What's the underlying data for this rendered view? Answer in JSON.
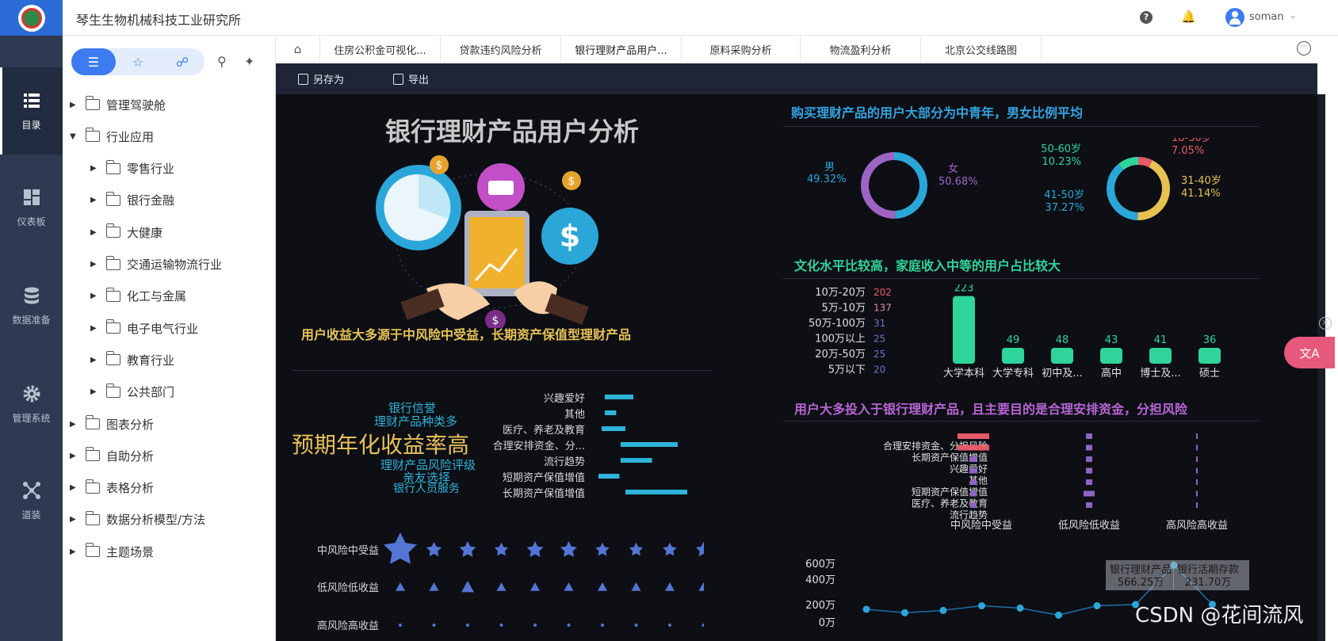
{
  "header": {
    "org": "琴生生物机械科技工业研究所",
    "help_glyph": "?",
    "user": "soman"
  },
  "nav": [
    {
      "label": "目录"
    },
    {
      "label": "仪表板"
    },
    {
      "label": "数据准备"
    },
    {
      "label": "管理系统"
    },
    {
      "label": "道装"
    }
  ],
  "tree": [
    {
      "label": "管理驾驶舱",
      "expanded": false
    },
    {
      "label": "行业应用",
      "expanded": true
    },
    {
      "label": "零售行业"
    },
    {
      "label": "银行金融"
    },
    {
      "label": "大健康"
    },
    {
      "label": "交通运输物流行业"
    },
    {
      "label": "化工与金属"
    },
    {
      "label": "电子电气行业"
    },
    {
      "label": "教育行业"
    },
    {
      "label": "公共部门"
    },
    {
      "label": "图表分析"
    },
    {
      "label": "自助分析"
    },
    {
      "label": "表格分析"
    },
    {
      "label": "数据分析模型/方法"
    },
    {
      "label": "主题场景"
    }
  ],
  "tabs": [
    {
      "label": "住房公积金可视化..."
    },
    {
      "label": "贷款违约风险分析"
    },
    {
      "label": "银行理财产品用户...",
      "active": true
    },
    {
      "label": "原料采购分析"
    },
    {
      "label": "物流盈利分析"
    },
    {
      "label": "北京公交线路图"
    }
  ],
  "toolbar": {
    "save_as": "另存为",
    "export": "导出"
  },
  "dashboard": {
    "title": "银行理财产品用户分析",
    "section_income": "用户收益大多源于中风险中受益，长期资产保值型理财产品",
    "section_age": "购买理财产品的用户大部分为中青年，男女比例平均",
    "section_edu": "文化水平比较高，家庭收入中等的用户占比较大",
    "section_purpose": "用户大多投入于银行理财产品，且主要目的是合理安排资金，分担风险"
  },
  "chart_data": [
    {
      "type": "pie",
      "title": "",
      "categories": [
        "男",
        "女"
      ],
      "values": [
        49.32,
        50.68
      ],
      "labels": [
        "49.32%",
        "50.68%"
      ]
    },
    {
      "type": "pie",
      "title": "",
      "categories": [
        "31-40岁",
        "41-50岁",
        "50-60岁",
        "18-30岁"
      ],
      "values": [
        41.14,
        37.27,
        10.23,
        7.05
      ],
      "labels": [
        "41.14%",
        "37.27%",
        "10.23%",
        "7.05%"
      ]
    },
    {
      "type": "table",
      "title": "",
      "rows": [
        [
          "10万-20万",
          "202"
        ],
        [
          "5万-10万",
          "137"
        ],
        [
          "50万-100万",
          "31"
        ],
        [
          "100万以上",
          "25"
        ],
        [
          "20万-50万",
          "25"
        ],
        [
          "5万以下",
          "20"
        ]
      ]
    },
    {
      "type": "bar",
      "title": "",
      "categories": [
        "大学本科",
        "大学专科",
        "初中及...",
        "高中",
        "博士及...",
        "硕士"
      ],
      "values": [
        223,
        49,
        48,
        43,
        41,
        36
      ],
      "ylim": [
        0,
        230
      ]
    },
    {
      "type": "bar",
      "title": "",
      "categories": [
        "兴趣爱好",
        "其他",
        "医疗、养老及教育",
        "合理安排资金、分...",
        "流行趋势",
        "短期资产保值增值",
        "长期资产保值增值"
      ],
      "values": [
        3,
        1.2,
        2.5,
        6,
        3.3,
        2.2,
        6.5
      ]
    },
    {
      "type": "scatter",
      "title": "",
      "categories": [
        "中风险中受益",
        "低风险低收益",
        "高风险高收益"
      ],
      "marks": [
        1,
        0.9,
        1,
        0.8,
        1,
        1,
        0.8,
        0.8,
        0.8,
        0.9
      ]
    },
    {
      "type": "line",
      "title": "",
      "ytick_labels": [
        "600万",
        "400万",
        "200万",
        "0万"
      ],
      "values": [
        190,
        160,
        180,
        220,
        200,
        140,
        220,
        230,
        566.25,
        231.7
      ],
      "annotations": [
        {
          "label": "银行理财产品",
          "value": "566.25万"
        },
        {
          "label": "银行活期存款",
          "value": "231.70万"
        }
      ],
      "ylim": [
        0,
        650
      ]
    }
  ],
  "wordcloud": [
    "银行信誉",
    "理财产品种类多",
    "预期年化收益率高",
    "理财产品风险评级",
    "亲友选择",
    "银行人员服务"
  ],
  "purpose_matrix": {
    "rows": [
      "合理安排资金、分担风险",
      "长期资产保值增值",
      "兴趣爱好",
      "其他",
      "短期资产保值增值",
      "医疗、养老及教育",
      "流行趋势"
    ],
    "cols": [
      "中风险中受益",
      "低风险低收益",
      "高风险高收益"
    ]
  },
  "watermark": "CSDN @花间流风",
  "translate_glyph": "文A",
  "close_glyph": "×"
}
